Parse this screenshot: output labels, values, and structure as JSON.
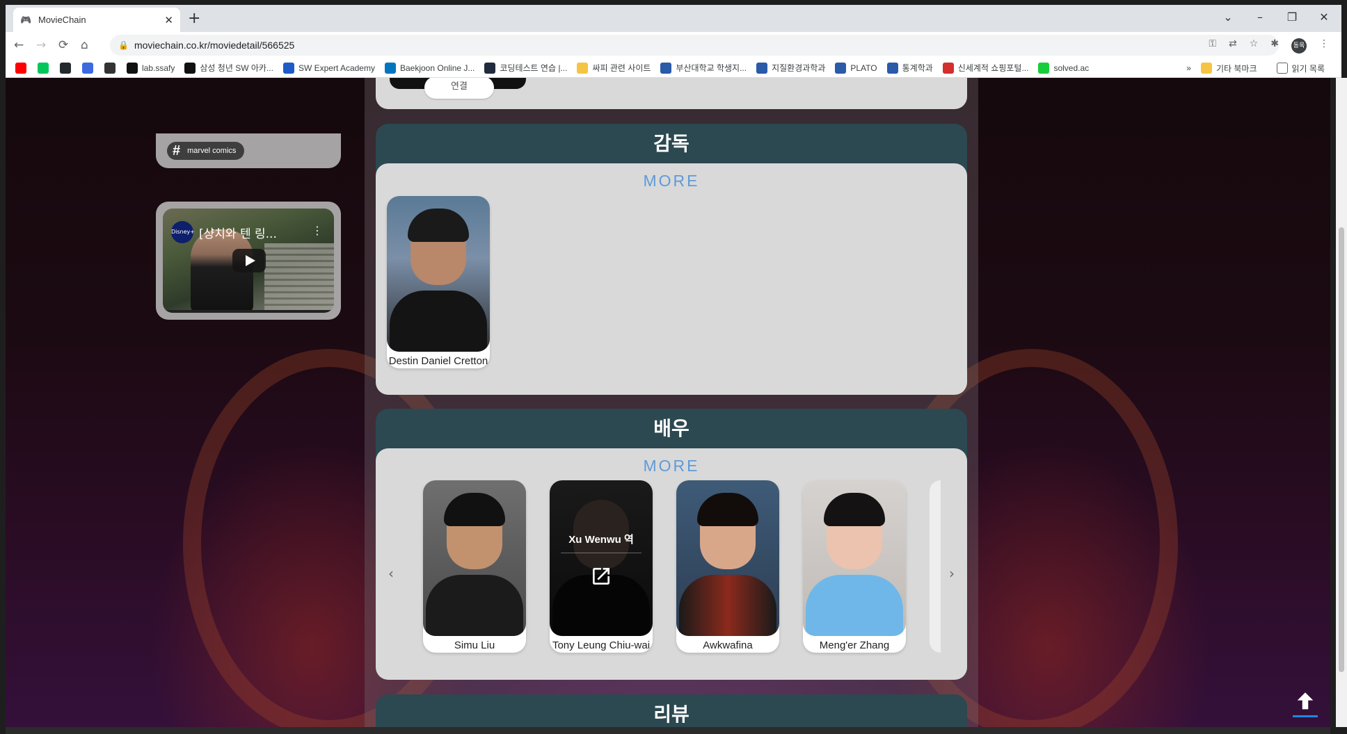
{
  "browser": {
    "tab_title": "MovieChain",
    "tab_close": "✕",
    "new_tab": "+",
    "url": "moviechain.co.kr/moviedetail/566525",
    "window_controls": {
      "tabs_menu": "⌄",
      "minimize": "–",
      "restore": "❐",
      "close": "✕"
    },
    "nav": {
      "back": "←",
      "forward": "→",
      "reload": "⟳",
      "home": "⌂"
    },
    "profile_initials": "동욱",
    "bookmarks": [
      {
        "label": "",
        "color": "#ff0000"
      },
      {
        "label": "",
        "color": "#03c75a"
      },
      {
        "label": "",
        "color": "#24292e"
      },
      {
        "label": "",
        "color": "#3d6ae0"
      },
      {
        "label": "",
        "color": "#333333"
      },
      {
        "label": "lab.ssafy",
        "color": "#111111"
      },
      {
        "label": "삼성 청년 SW 아카...",
        "color": "#111111"
      },
      {
        "label": "SW Expert Academy",
        "color": "#1e5bc6"
      },
      {
        "label": "Baekjoon Online J...",
        "color": "#0076c0"
      },
      {
        "label": "코딩테스트 연습 |...",
        "color": "#202b3d"
      },
      {
        "label": "싸피 관련 사이트",
        "color": "#f6c443"
      },
      {
        "label": "부산대학교 학생지...",
        "color": "#2a5aa8"
      },
      {
        "label": "지질환경과학과",
        "color": "#2a5aa8"
      },
      {
        "label": "PLATO",
        "color": "#2a5aa8"
      },
      {
        "label": "통계학과",
        "color": "#2a5aa8"
      },
      {
        "label": "신세계적 쇼핑포털...",
        "color": "#d32f2f"
      },
      {
        "label": "solved.ac",
        "color": "#17ce3a"
      }
    ],
    "bookmarks_overflow": "»",
    "other_bookmarks": "기타 북마크",
    "reading_list": "읽기 목록"
  },
  "sidebar": {
    "tag": "marvel comics",
    "video": {
      "channel": "Disney+",
      "title": "[샹치와 텐 링..."
    }
  },
  "prev_section": {
    "link_label": "연결"
  },
  "director_section": {
    "title": "감독",
    "more": "MORE",
    "people": [
      {
        "name": "Destin Daniel Cretton"
      }
    ]
  },
  "actor_section": {
    "title": "배우",
    "more": "MORE",
    "prev_arrow": "‹",
    "next_arrow": "›",
    "people": [
      {
        "name": "Simu Liu"
      },
      {
        "name": "Tony Leung Chiu-wai",
        "role": "Xu Wenwu 역"
      },
      {
        "name": "Awkwafina"
      },
      {
        "name": "Meng'er Zhang"
      }
    ]
  },
  "review_section": {
    "title": "리뷰"
  }
}
